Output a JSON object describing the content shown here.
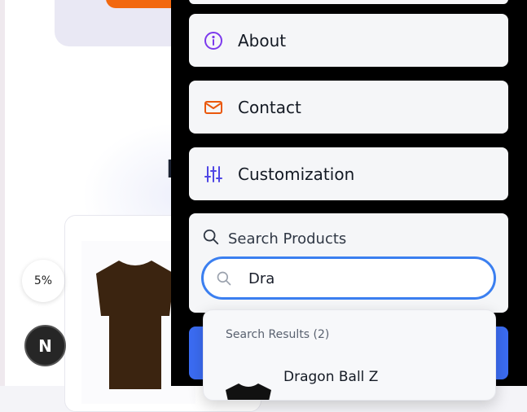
{
  "background": {
    "zoom_badge": "5%",
    "dev_badge": "N"
  },
  "menu": {
    "items": [
      {
        "label": "About",
        "icon": "info-icon",
        "color": "#7c3aed"
      },
      {
        "label": "Contact",
        "icon": "mail-icon",
        "color": "#ea580c"
      },
      {
        "label": "Customization",
        "icon": "sliders-icon",
        "color": "#4f46e5"
      }
    ]
  },
  "search": {
    "title": "Search Products",
    "value": "Dra",
    "focus_color": "#3b7ff0"
  },
  "results": {
    "header": "Search Results (2)",
    "items": [
      {
        "name": "Dragon Ball Z"
      }
    ]
  }
}
